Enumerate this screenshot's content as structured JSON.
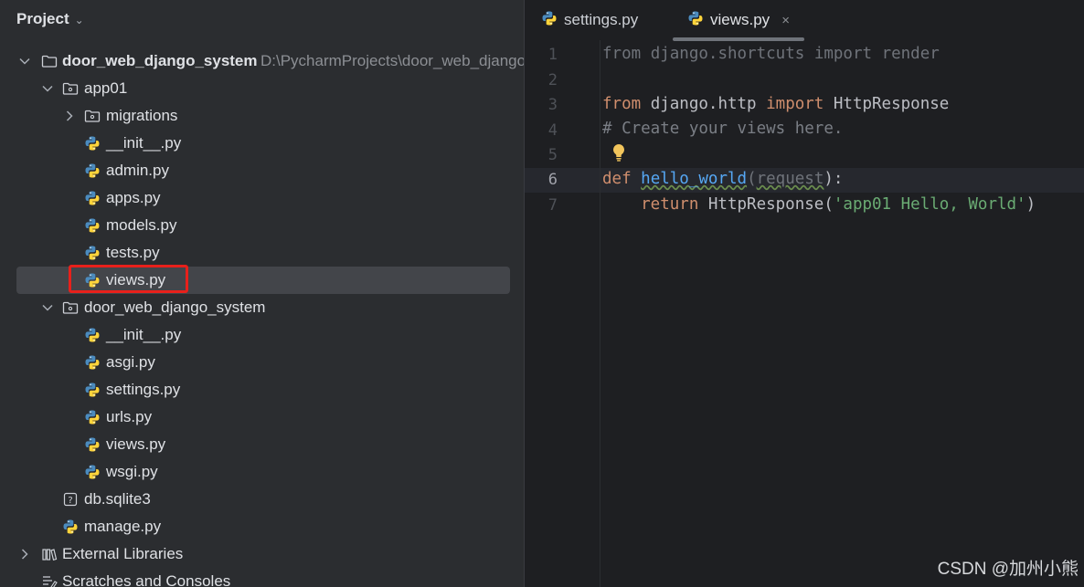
{
  "project_panel": {
    "title": "Project",
    "tree": [
      {
        "label": "door_web_django_system",
        "hint": "D:\\PycharmProjects\\door_web_django",
        "kind": "folder-root"
      },
      {
        "label": "app01",
        "kind": "package"
      },
      {
        "label": "migrations",
        "kind": "package"
      },
      {
        "label": "__init__.py",
        "kind": "python"
      },
      {
        "label": "admin.py",
        "kind": "python"
      },
      {
        "label": "apps.py",
        "kind": "python"
      },
      {
        "label": "models.py",
        "kind": "python"
      },
      {
        "label": "tests.py",
        "kind": "python"
      },
      {
        "label": "views.py",
        "kind": "python",
        "selected": true
      },
      {
        "label": "door_web_django_system",
        "kind": "package"
      },
      {
        "label": "__init__.py",
        "kind": "python"
      },
      {
        "label": "asgi.py",
        "kind": "python"
      },
      {
        "label": "settings.py",
        "kind": "python"
      },
      {
        "label": "urls.py",
        "kind": "python"
      },
      {
        "label": "views.py",
        "kind": "python"
      },
      {
        "label": "wsgi.py",
        "kind": "python"
      },
      {
        "label": "db.sqlite3",
        "kind": "unknown-file"
      },
      {
        "label": "manage.py",
        "kind": "python"
      },
      {
        "label": "External Libraries",
        "kind": "library"
      },
      {
        "label": "Scratches and Consoles",
        "kind": "scratches"
      }
    ]
  },
  "editor": {
    "tabs": [
      {
        "label": "settings.py",
        "active": false
      },
      {
        "label": "views.py",
        "active": true,
        "close": "×"
      }
    ],
    "line_numbers": [
      "1",
      "2",
      "3",
      "4",
      "5",
      "6",
      "7"
    ],
    "current_line": "6",
    "code": {
      "l1_from": "from",
      "l1_mod": " django.shortcuts ",
      "l1_import": "import",
      "l1_name": " render",
      "l3_from": "from",
      "l3_mod": " django.http ",
      "l3_import": "import",
      "l3_name": " HttpResponse",
      "l4_comment": "# Create your views here.",
      "l6_def": "def",
      "l6_fn": "hello_world",
      "l6_open": "(",
      "l6_param": "request",
      "l6_close": "):",
      "l7_return": "    return",
      "l7_call": " HttpResponse(",
      "l7_str": "'app01 Hello, World'",
      "l7_close": ")"
    }
  },
  "watermark": "CSDN @加州小熊",
  "colors": {
    "panel_bg": "#2b2d30",
    "editor_bg": "#1e1f22",
    "selection": "#43454a",
    "highlight_box": "#e8201b",
    "keyword": "#cf8e6d",
    "function": "#56a8f5",
    "string": "#6aab73"
  },
  "icons": {
    "python": "python-file-icon",
    "folder": "folder-icon",
    "package": "package-folder-icon",
    "unknown": "unknown-file-icon",
    "library": "library-icon",
    "scratches": "scratches-icon",
    "bulb": "lightbulb-icon"
  }
}
